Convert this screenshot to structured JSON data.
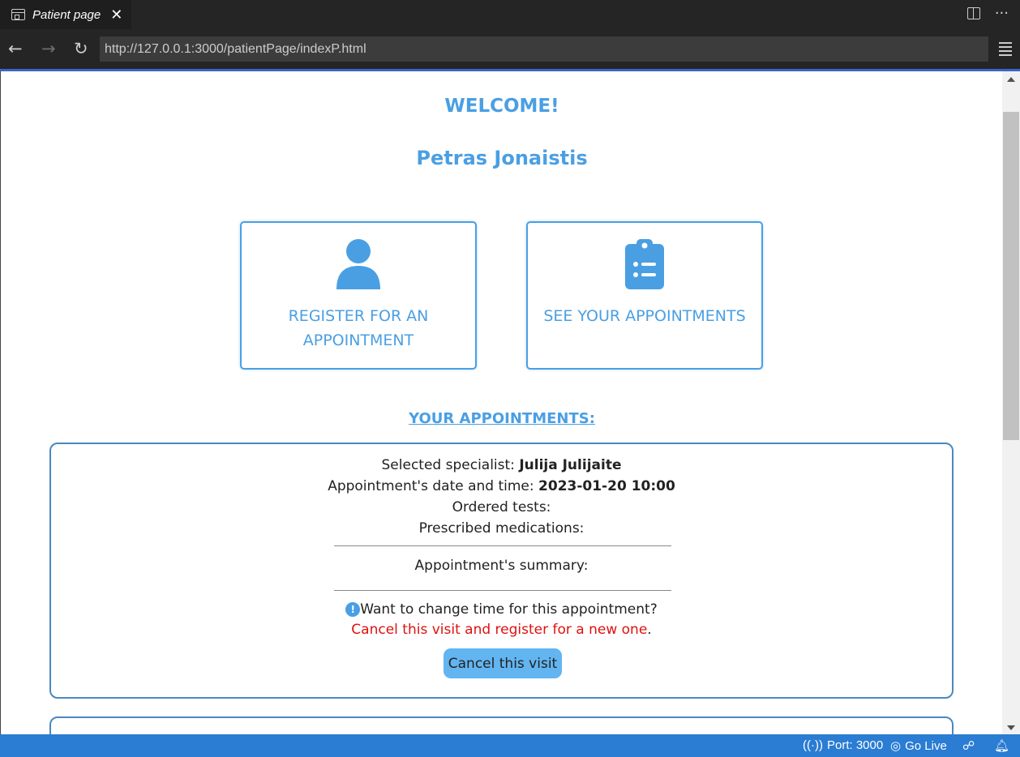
{
  "tab": {
    "title": "Patient page",
    "close": "✕"
  },
  "nav": {
    "url": "http://127.0.0.1:3000/patientPage/indexP.html",
    "back": "←",
    "forward": "→",
    "reload": "↻"
  },
  "page": {
    "welcome": "WELCOME!",
    "patient_name": "Petras Jonaistis",
    "cards": {
      "register": "REGISTER FOR AN APPOINTMENT",
      "appointments": "SEE YOUR APPOINTMENTS"
    },
    "your_appointments_heading": "YOUR APPOINTMENTS:",
    "appointment": {
      "specialist_label": "Selected specialist: ",
      "specialist": "Julija Julijaite",
      "datetime_label": "Appointment's date and time: ",
      "datetime": "2023-01-20 10:00",
      "tests_label": "Ordered tests:",
      "medications_label": "Prescribed medications:",
      "summary_label": "Appointment's summary:",
      "change_question": "Want to change time for this appointment?",
      "cancel_hint": "Cancel this visit and register for a new one",
      "cancel_hint_end": ".",
      "cancel_button": "Cancel this visit",
      "info_glyph": "!"
    }
  },
  "statusbar": {
    "port": "Port: 3000",
    "golive": "Go Live"
  },
  "colors": {
    "accent": "#4a9fe3",
    "statusbar": "#2b7cd3",
    "cancel_text": "#e01010",
    "button": "#62b5f0"
  }
}
